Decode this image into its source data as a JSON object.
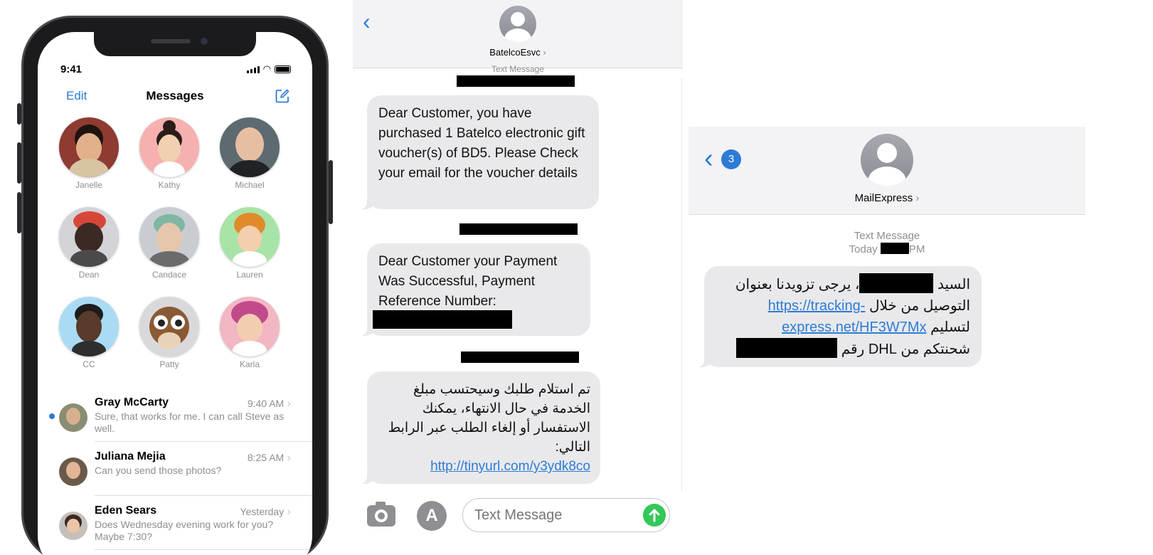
{
  "phone": {
    "time": "9:41",
    "edit_label": "Edit",
    "title": "Messages",
    "pinned": [
      "Janelle",
      "Kathy",
      "Michael",
      "Dean",
      "Candace",
      "Lauren",
      "CC",
      "Patty",
      "Karla"
    ],
    "conversations": [
      {
        "name": "Gray McCarty",
        "time": "9:40 AM",
        "preview": "Sure, that works for me. I can call Steve as well.",
        "unread": true
      },
      {
        "name": "Juliana Mejia",
        "time": "8:25 AM",
        "preview": "Can you send those photos?",
        "unread": false
      },
      {
        "name": "Eden Sears",
        "time": "Yesterday",
        "preview": "Does Wednesday evening work for you? Maybe 7:30?",
        "unread": false
      }
    ]
  },
  "sms1": {
    "contact": "BatelcoEsvc",
    "header_label": "Text Message",
    "messages": [
      "Dear Customer, you have purchased 1 Batelco electronic gift voucher(s) of BD5. Please Check your email for the voucher details",
      "Dear Customer your Payment Was Successful, Payment Reference Number:",
      "تم استلام طلبك وسيحتسب مبلغ الخدمة في حال الانتهاء، يمكنك الاستفسار أو إلغاء الطلب عبر الرابط التالي:"
    ],
    "link": "http://tinyurl.com/y3ydk8co",
    "input_placeholder": "Text Message"
  },
  "sms2": {
    "contact": "MailExpress",
    "back_badge": "3",
    "header_label": "Text Message",
    "day_label": "Today",
    "time_suffix": "PM",
    "msg_line1_a": "السيد",
    "msg_line1_b": "، يرجى تزويدنا بعنوان",
    "msg_line2_a": "التوصيل من خلال",
    "link_a": "https://tracking-",
    "link_b": "express.net/HF3W7Mx",
    "msg_line3_b": "لتسليم",
    "msg_line4_a": "شحنتكم من",
    "msg_line4_b": "DHL",
    "msg_line4_c": "رقم"
  },
  "colors": {
    "accent": "#2d7bd6",
    "bubble": "#e9e9eb",
    "send": "#34c759"
  }
}
